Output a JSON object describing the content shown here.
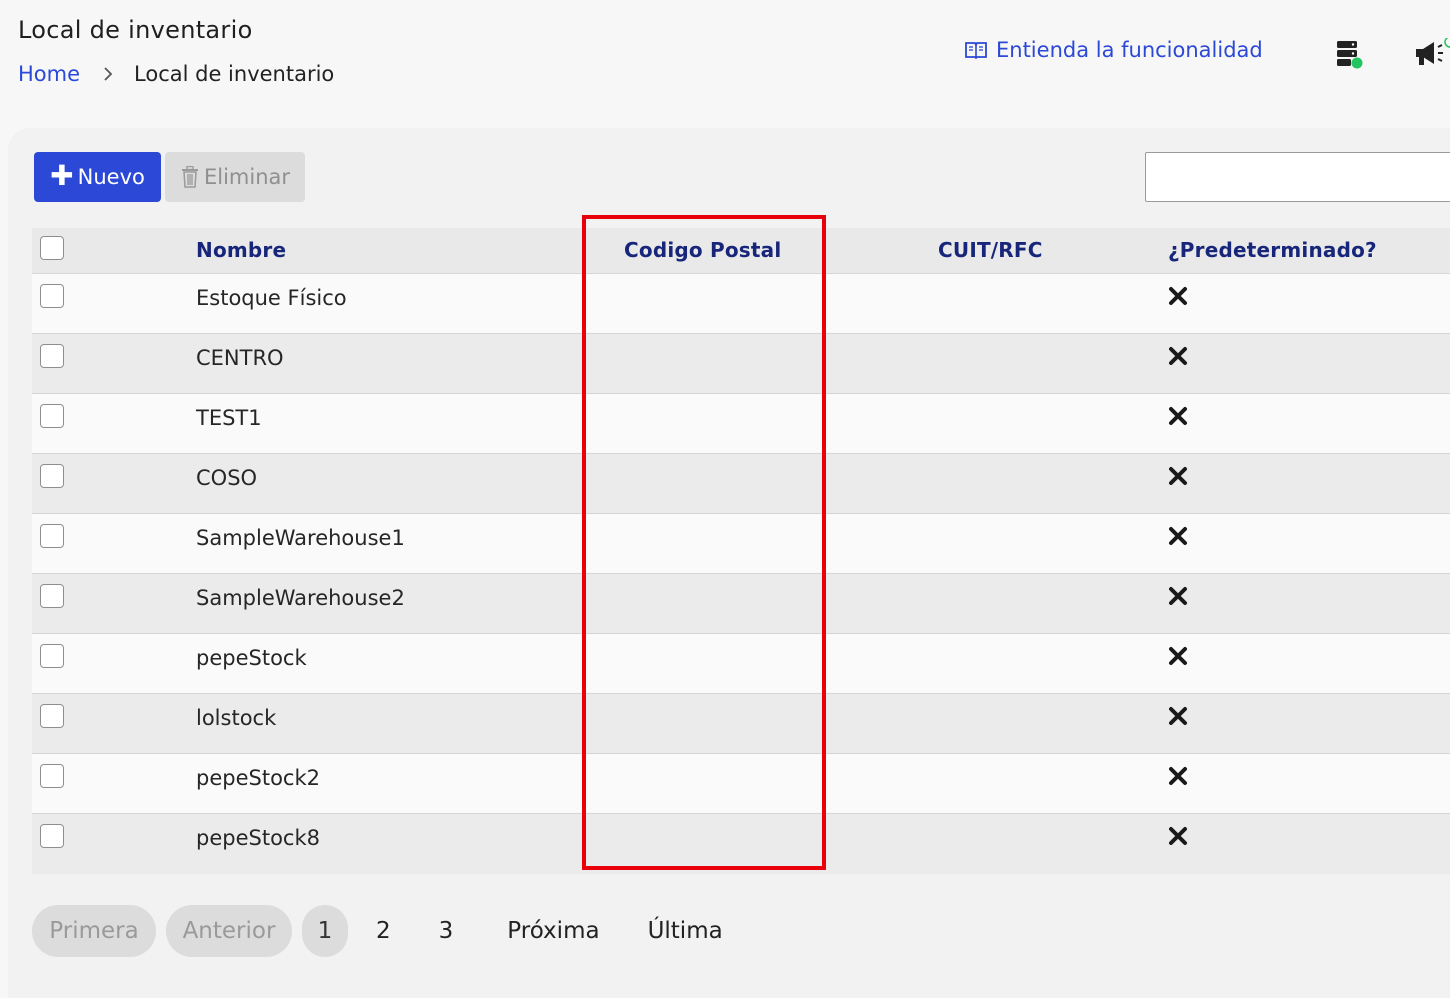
{
  "header": {
    "title": "Local de inventario",
    "breadcrumb": {
      "home": "Home",
      "current": "Local de inventario"
    },
    "help_link": "Entienda la funcionalidad"
  },
  "toolbar": {
    "new_label": "Nuevo",
    "delete_label": "Eliminar",
    "search_value": ""
  },
  "table": {
    "headers": {
      "name": "Nombre",
      "postal_code": "Codigo Postal",
      "tax_id": "CUIT/RFC",
      "default": "¿Predeterminado?"
    },
    "rows": [
      {
        "name": "Estoque Físico",
        "postal_code": "",
        "tax_id": "",
        "default": false
      },
      {
        "name": "CENTRO",
        "postal_code": "",
        "tax_id": "",
        "default": false
      },
      {
        "name": "TEST1",
        "postal_code": "",
        "tax_id": "",
        "default": false
      },
      {
        "name": "COSO",
        "postal_code": "",
        "tax_id": "",
        "default": false
      },
      {
        "name": "SampleWarehouse1",
        "postal_code": "",
        "tax_id": "",
        "default": false
      },
      {
        "name": "SampleWarehouse2",
        "postal_code": "",
        "tax_id": "",
        "default": false
      },
      {
        "name": "pepeStock",
        "postal_code": "",
        "tax_id": "",
        "default": false
      },
      {
        "name": "lolstock",
        "postal_code": "",
        "tax_id": "",
        "default": false
      },
      {
        "name": "pepeStock2",
        "postal_code": "",
        "tax_id": "",
        "default": false
      },
      {
        "name": "pepeStock8",
        "postal_code": "",
        "tax_id": "",
        "default": false
      }
    ]
  },
  "pagination": {
    "first": "Primera",
    "previous": "Anterior",
    "pages": [
      "1",
      "2",
      "3"
    ],
    "current_page": "1",
    "next": "Próxima",
    "last": "Última"
  },
  "colors": {
    "accent": "#2b48d6",
    "header_text": "#17267a",
    "highlight": "#e8000b",
    "status_online": "#22c55e"
  },
  "icons": {
    "breadcrumb_separator": "chevron-right-icon",
    "help": "book-icon",
    "server": "server-status-icon",
    "announcements": "megaphone-icon",
    "new": "plus-icon",
    "delete": "trash-icon",
    "default_false": "x-mark-icon"
  }
}
